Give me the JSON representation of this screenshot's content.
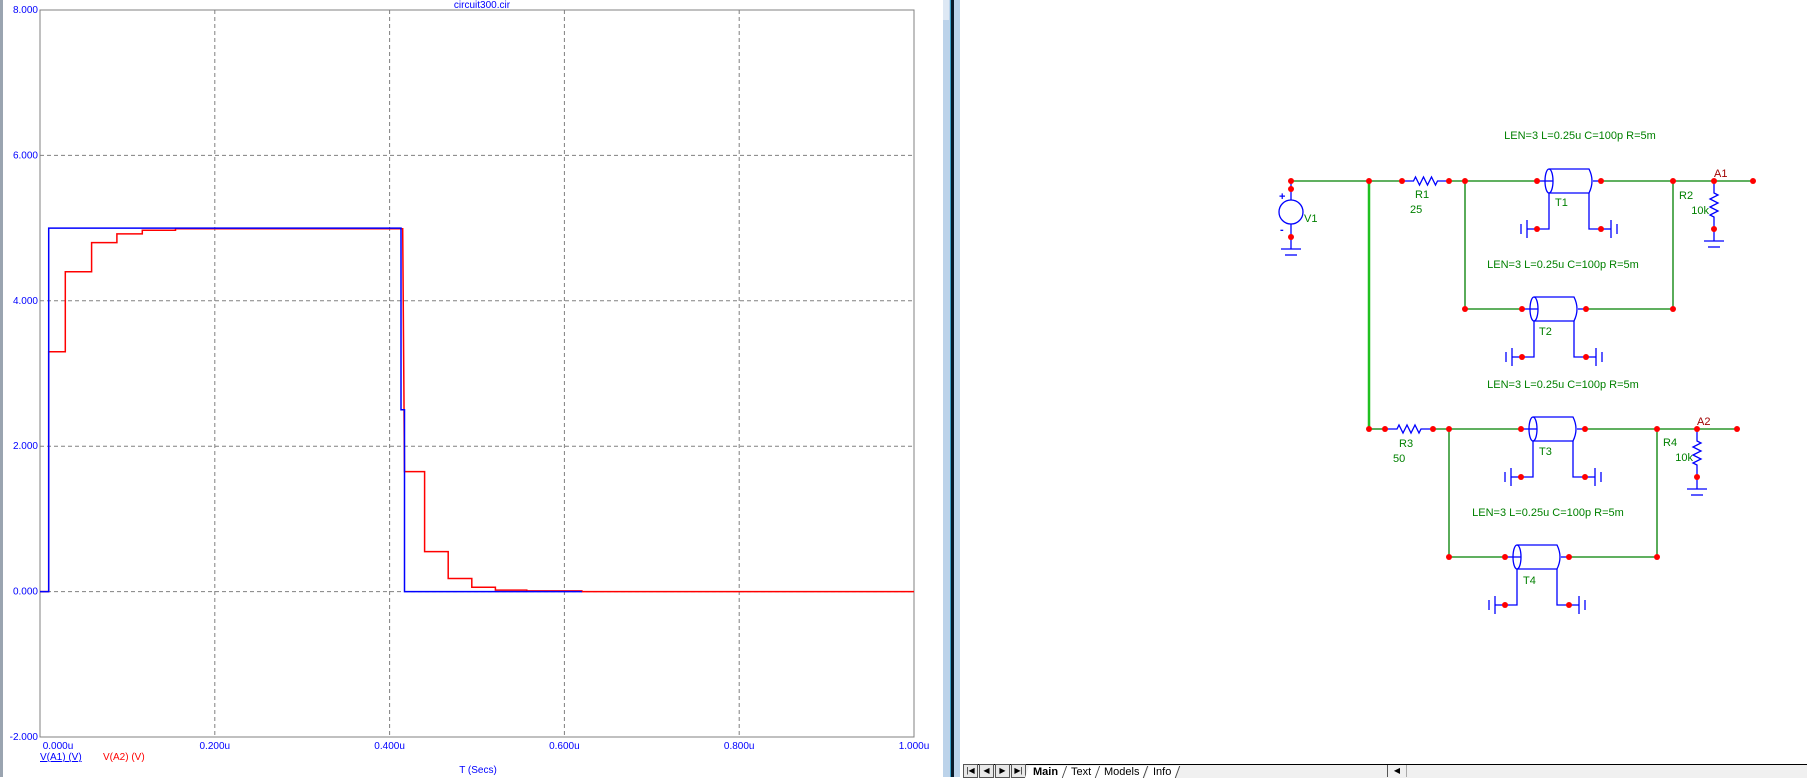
{
  "chart_data": {
    "type": "line",
    "title": "circuit300.cir",
    "xlabel": "T (Secs)",
    "ylabel": "",
    "xlim": [
      0,
      1.0
    ],
    "ylim": [
      -2,
      8
    ],
    "grid": true,
    "x_ticks": [
      "0.000u",
      "0.200u",
      "0.400u",
      "0.600u",
      "0.800u",
      "1.000u"
    ],
    "x_tick_values": [
      0,
      0.2,
      0.4,
      0.6,
      0.8,
      1.0
    ],
    "y_ticks": [
      "8.000",
      "6.000",
      "4.000",
      "2.000",
      "0.000",
      "-2.000"
    ],
    "y_tick_values": [
      8,
      6,
      4,
      2,
      0,
      -2
    ],
    "legend_placement": "bottom-left",
    "series": [
      {
        "name": "V(A1) (V)",
        "color": "#0000ff",
        "points": [
          [
            0,
            0
          ],
          [
            0.01,
            0
          ],
          [
            0.01,
            2.5
          ],
          [
            0.01,
            1.7
          ],
          [
            0.01,
            5
          ],
          [
            0.413,
            5
          ],
          [
            0.413,
            3.3
          ],
          [
            0.413,
            2.5
          ],
          [
            0.417,
            2.5
          ],
          [
            0.417,
            0
          ],
          [
            0.62,
            0
          ]
        ]
      },
      {
        "name": "V(A2) (V)",
        "color": "#ff0000",
        "points": [
          [
            0,
            0
          ],
          [
            0.01,
            0
          ],
          [
            0.01,
            3.3
          ],
          [
            0.029,
            3.3
          ],
          [
            0.029,
            4.4
          ],
          [
            0.059,
            4.4
          ],
          [
            0.059,
            4.8
          ],
          [
            0.088,
            4.8
          ],
          [
            0.088,
            4.92
          ],
          [
            0.117,
            4.92
          ],
          [
            0.117,
            4.97
          ],
          [
            0.155,
            4.97
          ],
          [
            0.155,
            4.99
          ],
          [
            0.415,
            4.99
          ],
          [
            0.417,
            1.65
          ],
          [
            0.44,
            1.65
          ],
          [
            0.44,
            0.55
          ],
          [
            0.467,
            0.55
          ],
          [
            0.467,
            0.18
          ],
          [
            0.494,
            0.18
          ],
          [
            0.494,
            0.06
          ],
          [
            0.521,
            0.06
          ],
          [
            0.521,
            0.02
          ],
          [
            0.557,
            0.02
          ],
          [
            0.557,
            0.01
          ],
          [
            0.62,
            0.01
          ],
          [
            0.62,
            0
          ],
          [
            1.0,
            0
          ]
        ]
      }
    ]
  },
  "schematic": {
    "tline_params": [
      "LEN=3 L=0.25u C=100p R=5m",
      "LEN=3 L=0.25u C=100p R=5m",
      "LEN=3 L=0.25u C=100p R=5m",
      "LEN=3 L=0.25u C=100p R=5m"
    ],
    "tlines": [
      "T1",
      "T2",
      "T3",
      "T4"
    ],
    "v1": {
      "name": "V1",
      "plus": "+",
      "minus": "-"
    },
    "r1": {
      "name": "R1",
      "value": "25"
    },
    "r2": {
      "name": "R2",
      "value": "10k"
    },
    "r3": {
      "name": "R3",
      "value": "50"
    },
    "r4": {
      "name": "R4",
      "value": "10k"
    },
    "a1": "A1",
    "a2": "A2"
  },
  "tabs": {
    "nav": [
      "|◀",
      "◀",
      "▶",
      "▶|"
    ],
    "items": [
      "Main",
      "Text",
      "Models",
      "Info"
    ],
    "active": "Main"
  },
  "colors": {
    "wire": "#008000",
    "component": "#0000ff",
    "node": "#ff0000",
    "label": "#008000",
    "axis_text": "#0000ff"
  }
}
